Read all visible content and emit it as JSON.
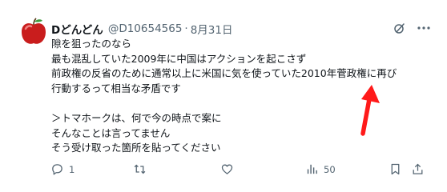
{
  "author": {
    "display_name": "Dどんどん",
    "handle": "@D10654565",
    "separator": "·",
    "date": "8月31日"
  },
  "post": {
    "lines": [
      "隙を狙ったのなら",
      "最も混乱していた2009年に中国はアクションを起こさず",
      "前政権の反省のために通常以上に米国に気を使っていた2010年菅政権に再び",
      "行動するって相当な矛盾です",
      "",
      "＞トマホークは、何で今の時点で案に",
      "そんなことは言ってません",
      "そう受け取った箇所を貼ってください"
    ]
  },
  "actions": {
    "reply_count": "1",
    "retweet_count": "",
    "like_count": "",
    "views_count": "50"
  },
  "icons": {
    "header": [
      "grok-icon",
      "more-icon"
    ],
    "actions": [
      "reply-icon",
      "retweet-icon",
      "like-icon",
      "views-icon",
      "bookmark-icon",
      "share-icon"
    ]
  },
  "colors": {
    "text": "#0f1419",
    "secondary": "#536471",
    "annotation_arrow": "#ff1a1a"
  }
}
